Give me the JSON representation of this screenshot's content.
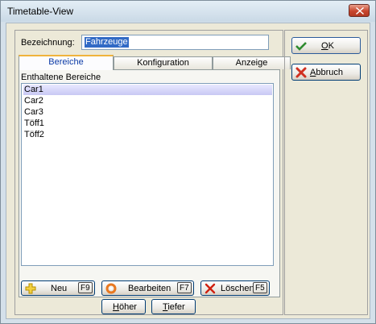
{
  "window": {
    "title": "Timetable-View"
  },
  "form": {
    "bezeichnung_label": "Bezeichnung:",
    "bezeichnung_value": "Fahrzeuge"
  },
  "tabs": [
    {
      "label": "Bereiche",
      "active": true
    },
    {
      "label": "Konfiguration",
      "active": false
    },
    {
      "label": "Anzeige",
      "active": false
    }
  ],
  "bereiche": {
    "label": "Enthaltene Bereiche",
    "items": [
      "Car1",
      "Car2",
      "Car3",
      "Töff1",
      "Töff2"
    ],
    "selected_index": 0
  },
  "buttons": {
    "neu": {
      "label": "Neu",
      "key": "F9"
    },
    "bearbeiten": {
      "label": "Bearbeiten",
      "key": "F7"
    },
    "loeschen": {
      "label": "Löschen",
      "key": "F5"
    },
    "hoeher": {
      "label_first": "H",
      "label_rest": "öher"
    },
    "tiefer": {
      "label_first": "T",
      "label_rest": "iefer"
    },
    "ok": {
      "label_first": "O",
      "label_rest": "K"
    },
    "abbruch": {
      "label_first": "A",
      "label_rest": "bbruch"
    }
  },
  "icons": {
    "close": "close-icon",
    "ok": "checkmark-icon",
    "abbruch": "cross-icon",
    "neu": "plus-icon",
    "bearbeiten": "edit-ring-icon",
    "loeschen": "delete-cross-icon"
  },
  "colors": {
    "selection": "#316ac5",
    "ok_check": "#2e8b2e",
    "cancel_cross": "#d03020",
    "plus": "#e8c020",
    "edit_ring": "#e87820"
  }
}
